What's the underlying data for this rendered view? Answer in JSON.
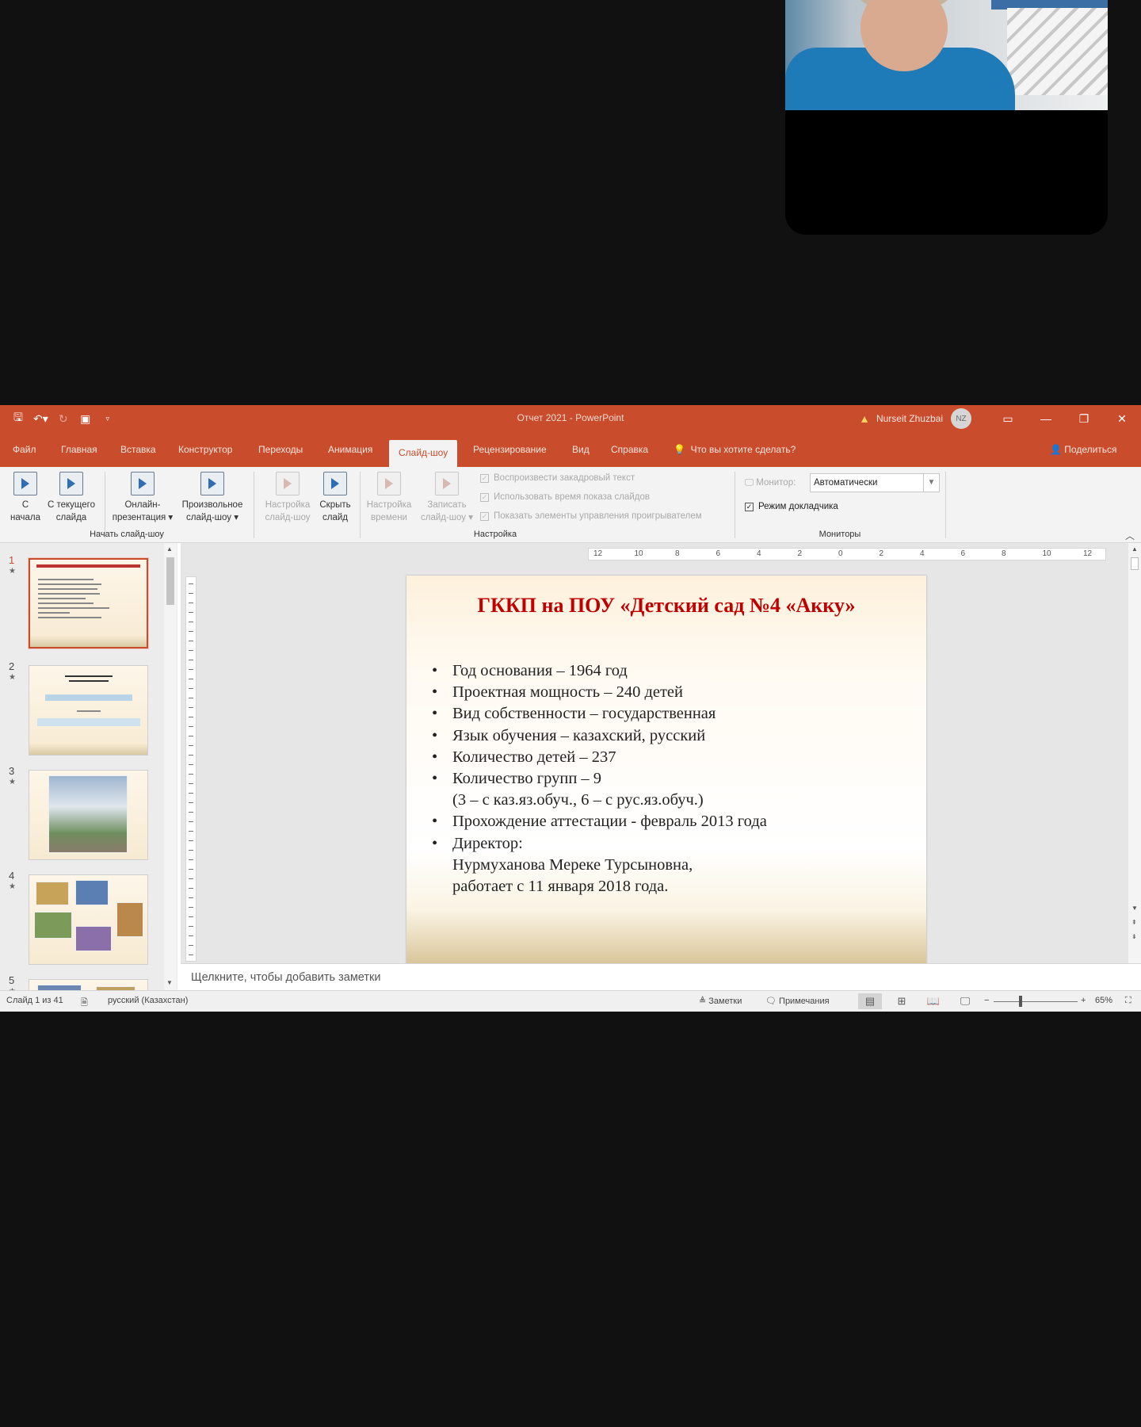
{
  "window": {
    "title": "Отчет 2021  -  PowerPoint",
    "user_name": "Nurseit Zhuzbai",
    "user_initials": "NZ"
  },
  "tabs": [
    {
      "label": "Файл"
    },
    {
      "label": "Главная"
    },
    {
      "label": "Вставка"
    },
    {
      "label": "Конструктор"
    },
    {
      "label": "Переходы"
    },
    {
      "label": "Анимация"
    },
    {
      "label": "Слайд-шоу",
      "active": true
    },
    {
      "label": "Рецензирование"
    },
    {
      "label": "Вид"
    },
    {
      "label": "Справка"
    }
  ],
  "tell_me": "Что вы хотите сделать?",
  "share": "Поделиться",
  "ribbon": {
    "start_group": {
      "label": "Начать слайд-шоу",
      "buttons": [
        {
          "line1": "С",
          "line2": "начала"
        },
        {
          "line1": "С текущего",
          "line2": "слайда"
        },
        {
          "line1": "Онлайн-",
          "line2": "презентация ▾"
        },
        {
          "line1": "Произвольное",
          "line2": "слайд-шоу ▾"
        }
      ]
    },
    "setup_group": {
      "label": "Настройка",
      "buttons": [
        {
          "line1": "Настройка",
          "line2": "слайд-шоу"
        },
        {
          "line1": "Скрыть",
          "line2": "слайд"
        },
        {
          "line1": "Настройка",
          "line2": "времени"
        },
        {
          "line1": "Записать",
          "line2": "слайд-шоу ▾"
        }
      ],
      "checkboxes": [
        {
          "label": "Воспроизвести закадровый текст"
        },
        {
          "label": "Использовать время показа слайдов"
        },
        {
          "label": "Показать элементы управления проигрывателем"
        }
      ]
    },
    "monitors_group": {
      "label": "Мониторы",
      "monitor_label": "Монитор:",
      "monitor_value": "Автоматически",
      "presenter_view": "Режим докладчика"
    }
  },
  "ruler": {
    "h_ticks": [
      "12",
      "10",
      "8",
      "6",
      "4",
      "2",
      "0",
      "2",
      "4",
      "6",
      "8",
      "10",
      "12"
    ]
  },
  "thumbnails": [
    {
      "num": "1"
    },
    {
      "num": "2"
    },
    {
      "num": "3"
    },
    {
      "num": "4"
    },
    {
      "num": "5"
    }
  ],
  "slide": {
    "title": "ГККП на ПОУ «Детский сад №4 «Акку»",
    "lines": [
      {
        "text": "Год основания – 1964 год",
        "bullet": true
      },
      {
        "text": "Проектная мощность – 240 детей",
        "bullet": true
      },
      {
        "text": "Вид собственности – государственная",
        "bullet": true
      },
      {
        "text": "Язык обучения – казахский, русский",
        "bullet": true
      },
      {
        "text": "Количество детей – 237",
        "bullet": true
      },
      {
        "text": "Количество групп – 9",
        "bullet": true
      },
      {
        "text": "(3 – с каз.яз.обуч., 6 – с рус.яз.обуч.)",
        "bullet": false
      },
      {
        "text": "Прохождение аттестации   -    февраль 2013 года",
        "bullet": true
      },
      {
        "text": "Директор:",
        "bullet": true
      },
      {
        "text": "Нурмуханова Мереке Турсыновна,",
        "bullet": false
      },
      {
        "text": "работает с 11 января 2018 года.",
        "bullet": false
      }
    ]
  },
  "notes_placeholder": "Щелкните, чтобы добавить заметки",
  "status": {
    "slide_counter": "Слайд 1 из 41",
    "language": "русский (Казахстан)",
    "notes": "Заметки",
    "comments": "Примечания",
    "zoom": "65%"
  }
}
